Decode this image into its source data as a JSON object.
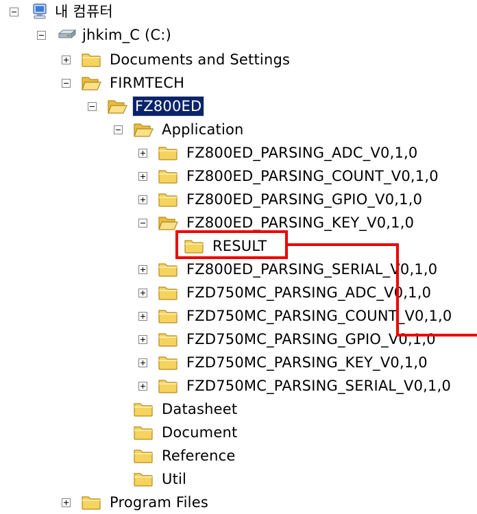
{
  "tree": {
    "my_computer": "내 컴퓨터",
    "drive": "jhkim_C (C:)",
    "documents_and_settings": "Documents and Settings",
    "firmtech": "FIRMTECH",
    "fz800ed": "FZ800ED",
    "application": "Application",
    "app_children": [
      "FZ800ED_PARSING_ADC_V0,1,0",
      "FZ800ED_PARSING_COUNT_V0,1,0",
      "FZ800ED_PARSING_GPIO_V0,1,0",
      "FZ800ED_PARSING_KEY_V0,1,0",
      "RESULT",
      "FZ800ED_PARSING_SERIAL_V0,1,0",
      "FZD750MC_PARSING_ADC_V0,1,0",
      "FZD750MC_PARSING_COUNT_V0,1,0",
      "FZD750MC_PARSING_GPIO_V0,1,0",
      "FZD750MC_PARSING_KEY_V0,1,0",
      "FZD750MC_PARSING_SERIAL_V0,1,0"
    ],
    "datasheet": "Datasheet",
    "document": "Document",
    "reference": "Reference",
    "util": "Util",
    "program_files": "Program Files"
  },
  "selected_item": "FZ800ED",
  "highlight_color": "#ee0000",
  "selection_color": "#0a246a"
}
